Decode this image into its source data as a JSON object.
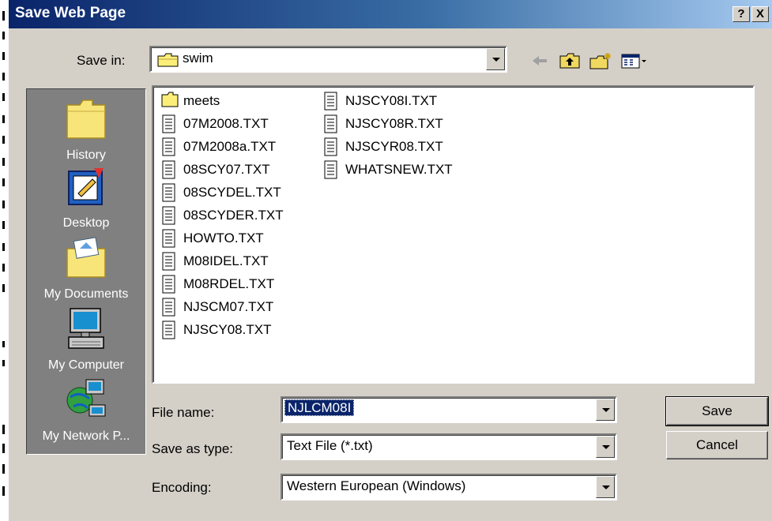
{
  "window": {
    "title": "Save Web Page",
    "help_button": "?",
    "close_button": "X"
  },
  "colors": {
    "title_start": "#0a246a",
    "title_end": "#a6caf0",
    "face": "#d4d0c8",
    "places_bg": "#808080",
    "selection": "#0a246a"
  },
  "save_in": {
    "label": "Save in:",
    "value": "swim",
    "icon": "folder-icon"
  },
  "toolbar": {
    "back_icon": "back-arrow-icon",
    "up_icon": "up-folder-icon",
    "new_folder_icon": "new-folder-icon",
    "view_icon": "view-menu-icon"
  },
  "places": [
    {
      "label": "History",
      "icon": "history-icon"
    },
    {
      "label": "Desktop",
      "icon": "desktop-icon"
    },
    {
      "label": "My Documents",
      "icon": "my-documents-icon"
    },
    {
      "label": "My Computer",
      "icon": "my-computer-icon"
    },
    {
      "label": "My Network P...",
      "icon": "network-places-icon"
    }
  ],
  "files": [
    {
      "name": "meets",
      "type": "folder"
    },
    {
      "name": "07M2008.TXT",
      "type": "text"
    },
    {
      "name": "07M2008a.TXT",
      "type": "text"
    },
    {
      "name": "08SCY07.TXT",
      "type": "text"
    },
    {
      "name": "08SCYDEL.TXT",
      "type": "text"
    },
    {
      "name": "08SCYDER.TXT",
      "type": "text"
    },
    {
      "name": "HOWTO.TXT",
      "type": "text"
    },
    {
      "name": "M08IDEL.TXT",
      "type": "text"
    },
    {
      "name": "M08RDEL.TXT",
      "type": "text"
    },
    {
      "name": "NJSCM07.TXT",
      "type": "text"
    },
    {
      "name": "NJSCY08.TXT",
      "type": "text"
    },
    {
      "name": "NJSCY08I.TXT",
      "type": "text"
    },
    {
      "name": "NJSCY08R.TXT",
      "type": "text"
    },
    {
      "name": "NJSCYR08.TXT",
      "type": "text"
    },
    {
      "name": "WHATSNEW.TXT",
      "type": "text"
    }
  ],
  "form": {
    "file_name": {
      "label": "File name:",
      "value": "NJLCM08I"
    },
    "save_as_type": {
      "label": "Save as type:",
      "value": "Text File (*.txt)"
    },
    "encoding": {
      "label": "Encoding:",
      "value": "Western European (Windows)"
    }
  },
  "buttons": {
    "save": "Save",
    "cancel": "Cancel"
  }
}
